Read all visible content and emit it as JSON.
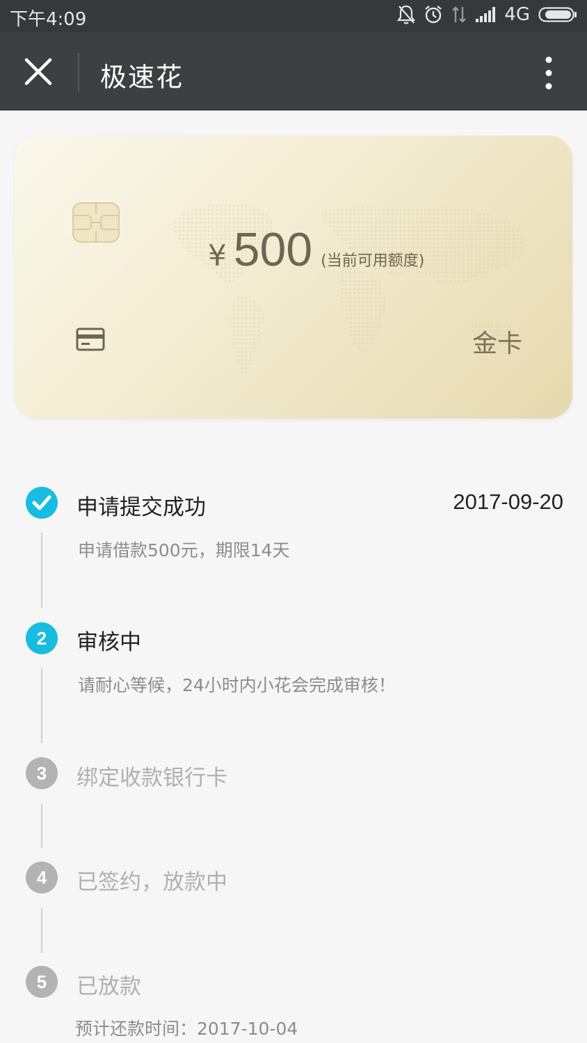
{
  "status_bar": {
    "time": "下午4:09",
    "network": "4G",
    "icons": [
      "mute-bell-icon",
      "alarm-icon",
      "data-transfer-icon",
      "signal-icon",
      "battery-icon"
    ]
  },
  "title_bar": {
    "title": "极速花",
    "close_icon": "close-icon",
    "more_icon": "more-vertical-icon"
  },
  "card": {
    "currency": "¥",
    "amount": "500",
    "amount_note": "(当前可用额度)",
    "tier": "金卡"
  },
  "steps": [
    {
      "number": "✓",
      "title": "申请提交成功",
      "date": "2017-09-20",
      "sub": "申请借款500元，期限14天",
      "state": "done"
    },
    {
      "number": "2",
      "title": "审核中",
      "sub": "请耐心等候，24小时内小花会完成审核！",
      "state": "active"
    },
    {
      "number": "3",
      "title": "绑定收款银行卡",
      "state": "pending"
    },
    {
      "number": "4",
      "title": "已签约，放款中",
      "state": "pending"
    },
    {
      "number": "5",
      "title": "已放款",
      "sub": "预计还款时间：2017-10-04",
      "state": "pending"
    }
  ],
  "colors": {
    "accent": "#17bde0",
    "inactive": "#b3b3b3",
    "title_bar": "#3d3f43"
  }
}
